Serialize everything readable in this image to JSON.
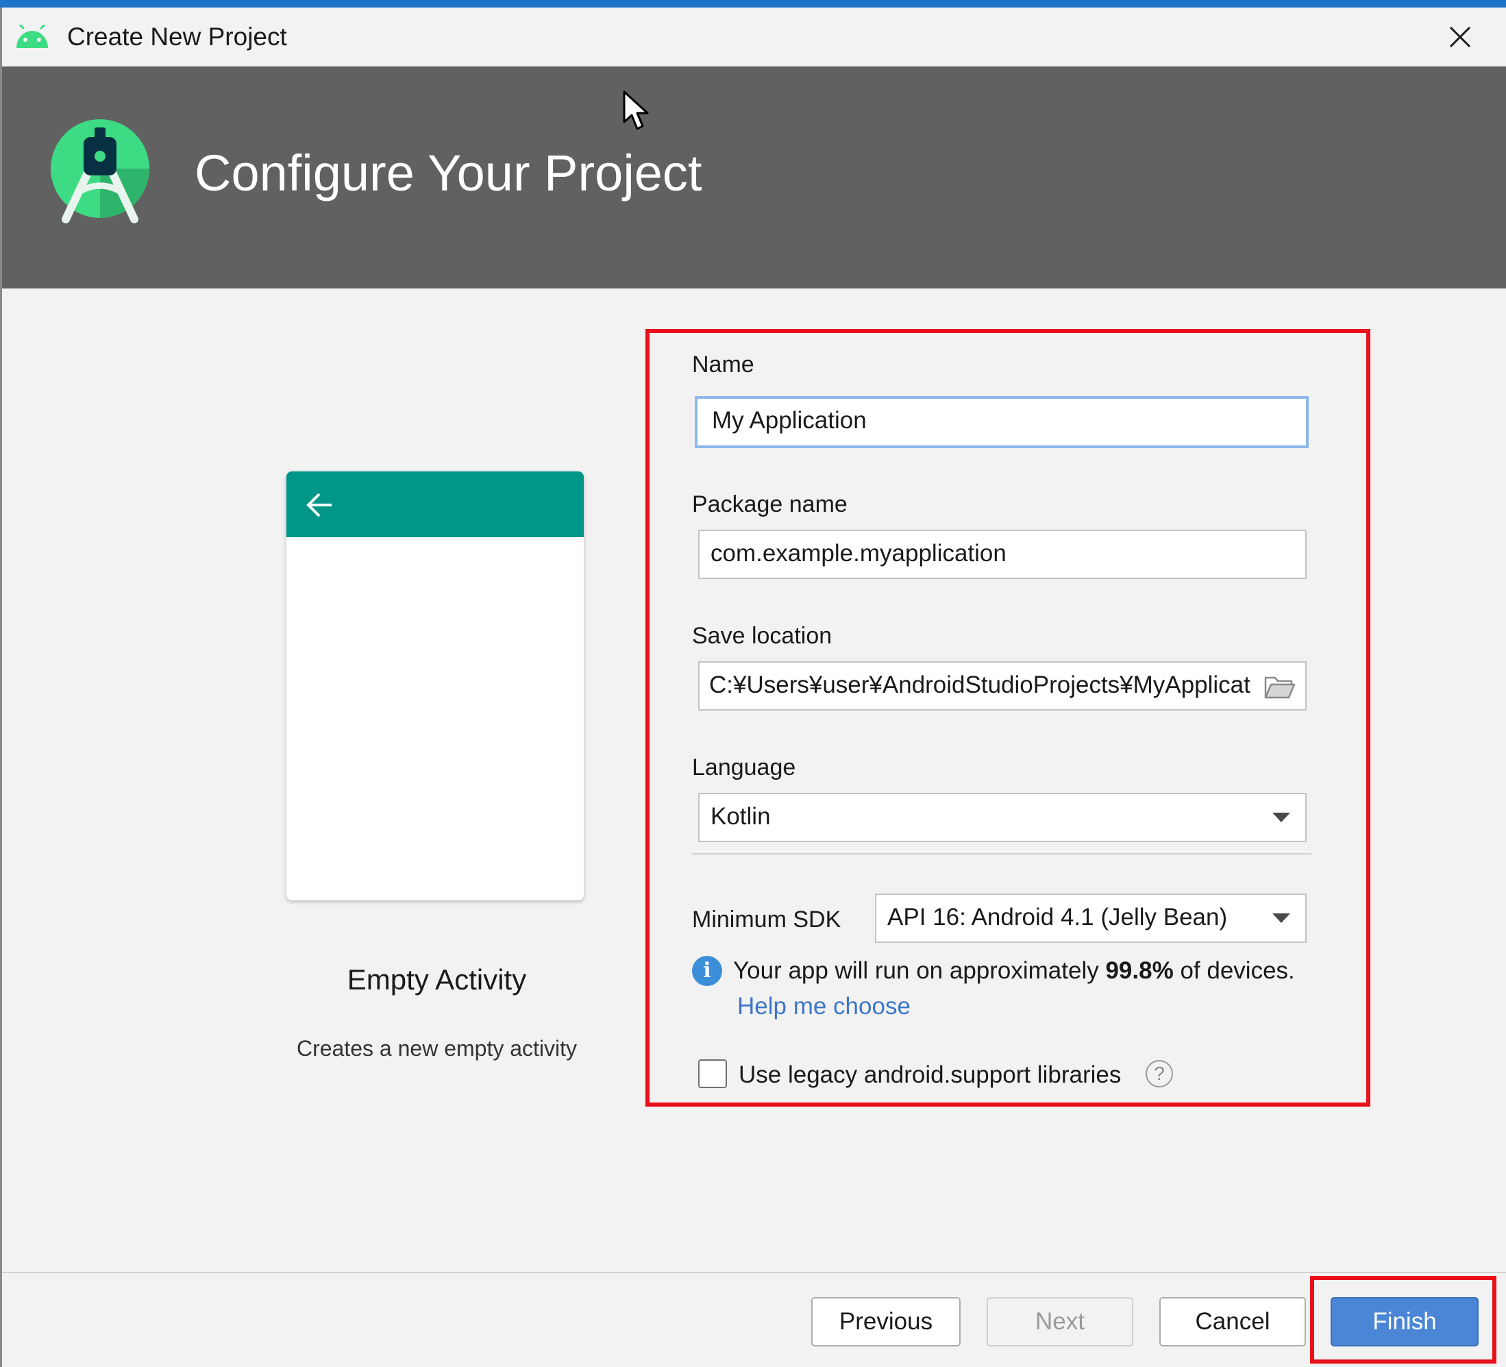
{
  "window": {
    "title": "Create New Project",
    "accent_color": "#1f74c9"
  },
  "header": {
    "title": "Configure Your Project",
    "background": "#616161"
  },
  "preview": {
    "template_name": "Empty Activity",
    "template_description": "Creates a new empty activity",
    "appbar_color": "#009688"
  },
  "form": {
    "name_label": "Name",
    "name_value": "My Application",
    "package_label": "Package name",
    "package_value": "com.example.myapplication",
    "save_location_label": "Save location",
    "save_location_value": "C:¥Users¥user¥AndroidStudioProjects¥MyApplication",
    "language_label": "Language",
    "language_value": "Kotlin",
    "min_sdk_label": "Minimum SDK",
    "min_sdk_value": "API 16: Android 4.1 (Jelly Bean)",
    "coverage_prefix": "Your app will run on approximately ",
    "coverage_percent": "99.8%",
    "coverage_suffix": " of devices.",
    "help_link": "Help me choose",
    "legacy_label": "Use legacy android.support libraries",
    "legacy_checked": false
  },
  "footer": {
    "previous_label": "Previous",
    "next_label": "Next",
    "cancel_label": "Cancel",
    "finish_label": "Finish",
    "finish_color": "#4a86d5"
  },
  "annotations": {
    "highlight_color": "#e8111b"
  }
}
